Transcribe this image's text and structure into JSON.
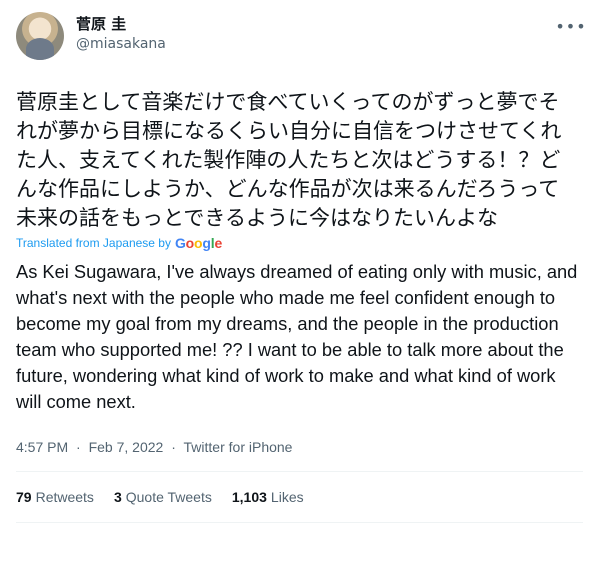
{
  "user": {
    "display_name": "菅原 圭",
    "handle": "@miasakana"
  },
  "icons": {
    "more": "more-horizontal-icon",
    "avatar": "profile-avatar"
  },
  "tweet": {
    "original_text": "菅原圭として音楽だけで食べていくってのがずっと夢でそれが夢から目標になるくらい自分に自信をつけさせてくれた人、支えてくれた製作陣の人たちと次はどうする！？どんな作品にしようか、どんな作品が次は来るんだろうって未来の話をもっとできるように今はなりたいんよな",
    "translated_label": "Translated from Japanese by",
    "translated_provider": "Google",
    "translation_text": "As Kei Sugawara, I've always dreamed of eating only with music, and what's next with the people who made me feel confident enough to become my goal from my dreams, and the people in the production team who supported me! ?? I want to be able to talk more about the future, wondering what kind of work to make and what kind of work will come next."
  },
  "meta": {
    "time": "4:57 PM",
    "separator": "·",
    "date": "Feb 7, 2022",
    "source": "Twitter for iPhone"
  },
  "stats": {
    "retweets_count": "79",
    "retweets_label": "Retweets",
    "quotes_count": "3",
    "quotes_label": "Quote Tweets",
    "likes_count": "1,103",
    "likes_label": "Likes"
  },
  "colors": {
    "link": "#1d9bf0",
    "secondary_text": "#536471",
    "primary_text": "#0f1419"
  }
}
